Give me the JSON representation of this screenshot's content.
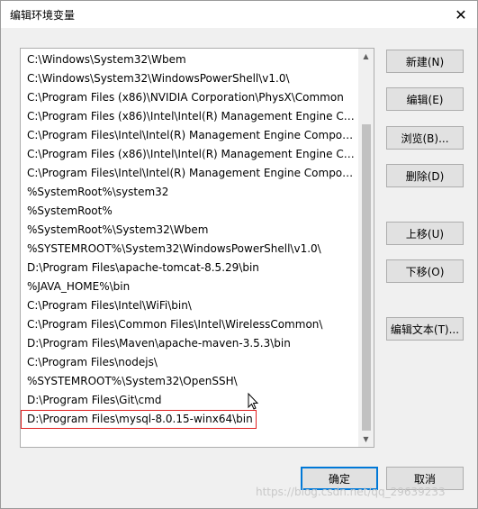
{
  "window": {
    "title": "编辑环境变量",
    "close_glyph": "✕"
  },
  "path_list": {
    "items": [
      "C:\\Windows\\System32\\Wbem",
      "C:\\Windows\\System32\\WindowsPowerShell\\v1.0\\",
      "C:\\Program Files (x86)\\NVIDIA Corporation\\PhysX\\Common",
      "C:\\Program Files (x86)\\Intel\\Intel(R) Management Engine Co...",
      "C:\\Program Files\\Intel\\Intel(R) Management Engine Compon...",
      "C:\\Program Files (x86)\\Intel\\Intel(R) Management Engine Co...",
      "C:\\Program Files\\Intel\\Intel(R) Management Engine Compon...",
      "%SystemRoot%\\system32",
      "%SystemRoot%",
      "%SystemRoot%\\System32\\Wbem",
      "%SYSTEMROOT%\\System32\\WindowsPowerShell\\v1.0\\",
      "D:\\Program Files\\apache-tomcat-8.5.29\\bin",
      "%JAVA_HOME%\\bin",
      "C:\\Program Files\\Intel\\WiFi\\bin\\",
      "C:\\Program Files\\Common Files\\Intel\\WirelessCommon\\",
      "D:\\Program Files\\Maven\\apache-maven-3.5.3\\bin",
      "C:\\Program Files\\nodejs\\",
      "%SYSTEMROOT%\\System32\\OpenSSH\\",
      "D:\\Program Files\\Git\\cmd",
      "D:\\Program Files\\mysql-8.0.15-winx64\\bin"
    ]
  },
  "buttons": {
    "new": "新建(N)",
    "edit": "编辑(E)",
    "browse": "浏览(B)...",
    "delete": "删除(D)",
    "move_up": "上移(U)",
    "move_down": "下移(O)",
    "edit_text": "编辑文本(T)...",
    "ok": "确定",
    "cancel": "取消"
  },
  "watermark": "https://blog.csdn.net/qq_29639233",
  "colors": {
    "edit_highlight": "#e02020",
    "default_button_border": "#0078d7"
  }
}
